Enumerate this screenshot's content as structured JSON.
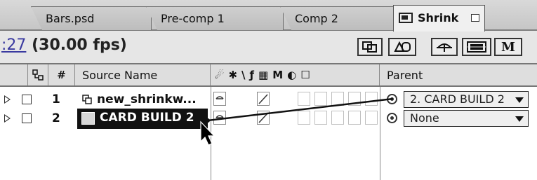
{
  "tabs": [
    {
      "label": "Bars.psd"
    },
    {
      "label": "Pre-comp 1"
    },
    {
      "label": "Comp 2"
    },
    {
      "label": "Shrink",
      "active": true
    }
  ],
  "timecode": {
    "value": ":27",
    "fps": "(30.00 fps)"
  },
  "toolbar": {
    "m_label": "M"
  },
  "columns": {
    "number": "#",
    "source_name": "Source Name",
    "parent": "Parent",
    "switch_icons": [
      "☄",
      "✱",
      "\\",
      "ƒ",
      "▦",
      "M",
      "◐",
      "☐"
    ]
  },
  "layers": [
    {
      "number": "1",
      "source_name": "new_shrinkw...",
      "parent": "2. CARD BUILD 2"
    },
    {
      "number": "2",
      "source_name": "CARD BUILD 2",
      "parent": "None",
      "selected": true
    }
  ],
  "colors": {
    "accent": "#3a3aa0",
    "selection": "#111111"
  }
}
